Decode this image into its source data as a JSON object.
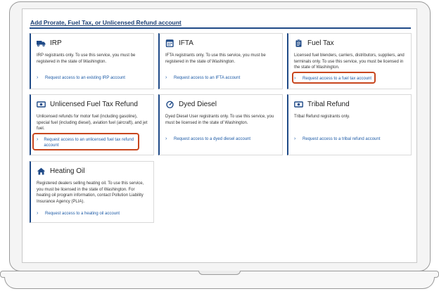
{
  "page": {
    "title": "Add Prorate, Fuel Tax, or Unlicensed Refund account"
  },
  "cards": [
    {
      "id": "irp",
      "icon": "truck-icon",
      "title": "IRP",
      "desc": "IRP registrants only. To use this service, you must be registered in the state of Washington.",
      "link": "Request access to an existing IRP account"
    },
    {
      "id": "ifta",
      "icon": "calendar-icon",
      "title": "IFTA",
      "desc": "IFTA registrants only. To use this service, you must be registered in the state of Washington.",
      "link": "Request access to an IFTA account"
    },
    {
      "id": "fuel-tax",
      "icon": "clipboard-icon",
      "title": "Fuel Tax",
      "desc": "Licensed fuel blenders, carriers, distributors, suppliers, and terminals only. To use this service, you must be licensed in the state of Washington.",
      "link": "Request access to a fuel tax account"
    },
    {
      "id": "unlicensed",
      "icon": "money-icon",
      "title": "Unlicensed Fuel Tax Refund",
      "desc": "Unlicensed refunds for motor fuel (including gasoline), special fuel (including diesel), aviation fuel (aircraft), and jet fuel.",
      "link": "Request access to an unlicensed fuel tax refund account"
    },
    {
      "id": "dyed-diesel",
      "icon": "gauge-icon",
      "title": "Dyed Diesel",
      "desc": "Dyed Diesel User registrants only. To use this service, you must be licensed in the state of Washington.",
      "link": "Request access to a dyed diesel account"
    },
    {
      "id": "tribal",
      "icon": "money-icon",
      "title": "Tribal Refund",
      "desc": "Tribal Refund registrants only.",
      "link": "Request access to a tribal refund account"
    },
    {
      "id": "heating-oil",
      "icon": "home-icon",
      "title": "Heating Oil",
      "desc": "Registered dealers selling heating oil. To use this service, you must be licensed in the state of Washington. For heating oil program information, contact Pollution Liability Insurance Agency (PLIA).",
      "link": "Request access to a heating oil account"
    }
  ],
  "colors": {
    "accent": "#1f4a87",
    "link": "#1c5aa6",
    "highlight": "#c8461e"
  }
}
